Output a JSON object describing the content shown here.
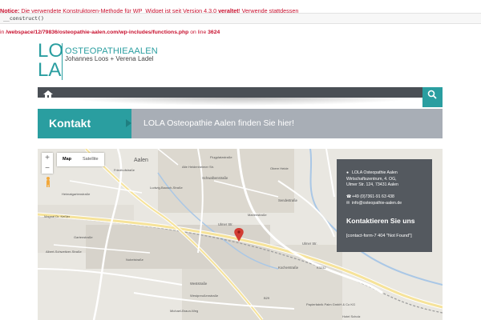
{
  "notice": {
    "prefix": "Notice:",
    "message_1": " Die verwendete Konstruktoren-Methode für WP_Widget ist seit Version 4.3.0 ",
    "strong": "veraltet",
    "message_2": "! Verwende stattdessen",
    "code": "__construct()",
    "in_text": "in ",
    "path": "/webspace/12/79836/osteopathie-aalen.com/wp-includes/functions.php",
    "line_text": " on line ",
    "line_no": "3624"
  },
  "logo": {
    "mark_top": "LO",
    "mark_bottom": "LA",
    "brand_main": "OSTEOPATHIE",
    "brand_city": "AALEN",
    "names": "Johannes Loos + Verena Ladel"
  },
  "nav": {
    "home_icon": "home-icon",
    "search_icon": "search-icon"
  },
  "title": {
    "left": "Kontakt",
    "right": "LOLA Osteopathie Aalen finden Sie hier!"
  },
  "map": {
    "zoom_in": "+",
    "zoom_out": "−",
    "type_map": "Map",
    "type_satellite": "Satellite",
    "labels": {
      "aalen": "Aalen",
      "schwalbenstrasse": "Schwalbenstraße",
      "ulmer_str_1": "Ulmer Str.",
      "ulmer_str_2": "Ulmer Str.",
      "sendestrasse": "Sendestraße",
      "kocherstrasse": "Kocherstraße",
      "weststrasse": "Weststraße",
      "papierfabrik": "Papierfabrik Palm GmbH & Co KG",
      "hotel": "Hotel Scholz",
      "b29": "B29",
      "k3232": "K3232",
      "alte_heidenheimer": "Alte Heidenheimer Str.",
      "ludwig": "Ludwig-Bausch-Straße",
      "friedhof": "Friedhofstraße",
      "heimatgarten": "Heimatgartenstraße",
      "garten": "Gartenstraße",
      "flugplatz": "Flugplatzstraße",
      "marienstrasse": "Marienstraße",
      "michael": "Michael-Braun-Weg",
      "westpreussen": "Westpreußenstraße",
      "nobel": "Nobelstraße",
      "dr_kessler": "Magnal Dr. Keßler",
      "albert": "Albert-Schweitzer-Straße",
      "obere_heide": "Obere Heide"
    },
    "info": {
      "name": "LOLA Osteopathie Aalen",
      "address_1": "Wirtschaftszentrum, 4. OG,",
      "address_2": "Ulmer Str. 124, 73431 Aalen",
      "phone": "+49 (0)7361-91 63 438",
      "email": "info@osteopathie-aalen.de",
      "heading": "Kontaktieren Sie uns",
      "form_error": "[contact-form-7 404 \"Not Found\"]"
    }
  },
  "colors": {
    "accent": "#2a9ea0",
    "nav": "#4a4f55",
    "title_right": "#a8aeb6",
    "notice": "#c8102e",
    "info_box": "#54595f",
    "pin": "#d23c33"
  }
}
